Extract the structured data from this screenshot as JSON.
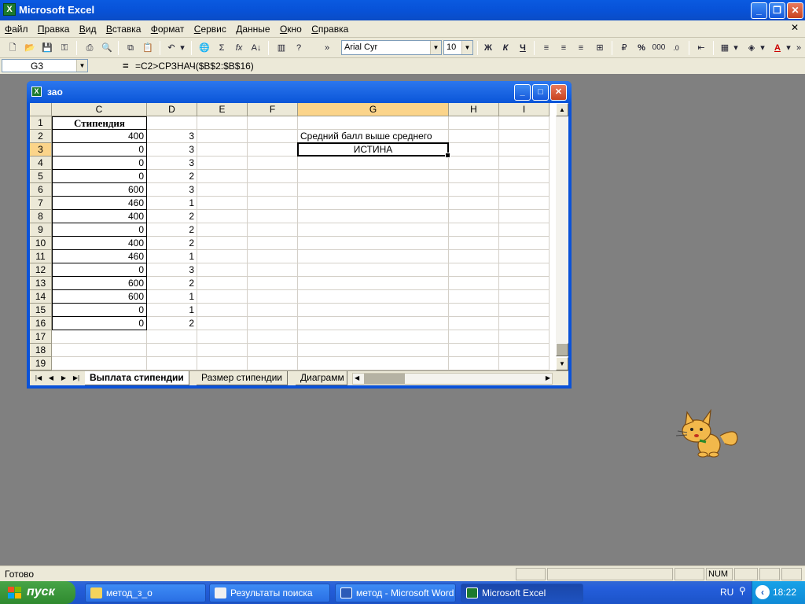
{
  "app": {
    "title": "Microsoft Excel"
  },
  "menu": [
    "Файл",
    "Правка",
    "Вид",
    "Вставка",
    "Формат",
    "Сервис",
    "Данные",
    "Окно",
    "Справка"
  ],
  "toolbar": {
    "font_name": "Arial Cyr",
    "font_size": "10",
    "bold": "Ж",
    "italic": "К",
    "underline": "Ч",
    "percent": "%",
    "thousands": "000"
  },
  "formula_bar": {
    "cell_ref": "G3",
    "eq": "=",
    "formula": "=C2>СРЗНАЧ($B$2:$B$16)"
  },
  "workbook": {
    "title": "зао",
    "columns": [
      "C",
      "D",
      "E",
      "F",
      "G",
      "H",
      "I"
    ],
    "rows": [
      "1",
      "2",
      "3",
      "4",
      "5",
      "6",
      "7",
      "8",
      "9",
      "10",
      "11",
      "12",
      "13",
      "14",
      "15",
      "16",
      "17",
      "18",
      "19"
    ],
    "col_c": [
      "Стипендия",
      "400",
      "0",
      "0",
      "0",
      "600",
      "460",
      "400",
      "0",
      "400",
      "460",
      "0",
      "600",
      "600",
      "0",
      "0"
    ],
    "col_d": [
      "",
      "3",
      "3",
      "3",
      "2",
      "3",
      "1",
      "2",
      "2",
      "2",
      "1",
      "3",
      "2",
      "1",
      "1",
      "2"
    ],
    "g2": "Средний балл выше среднего",
    "g3": "ИСТИНА",
    "sheet_tabs": [
      "Выплата стипендии",
      "Размер стипендии",
      "Диаграмм"
    ]
  },
  "status": {
    "text": "Готово",
    "num": "NUM"
  },
  "taskbar": {
    "start": "пуск",
    "buttons": [
      "метод_з_о",
      "Результаты поиска",
      "метод - Microsoft Word",
      "Microsoft Excel"
    ],
    "lang": "RU",
    "clock": "18:22"
  }
}
